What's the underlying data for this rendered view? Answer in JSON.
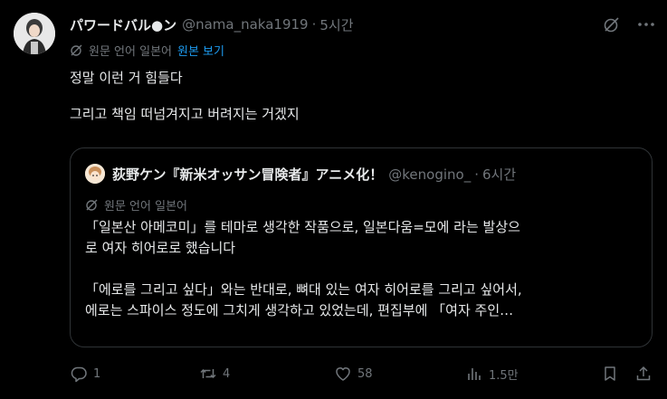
{
  "tweet": {
    "display_name": "パワードバル●ン",
    "handle": "@nama_naka1919",
    "separator": "·",
    "time": "5시간",
    "translate": {
      "label": "원문 언어 일본어",
      "show_original": "원본 보기"
    },
    "body_lines": [
      "정말 이런 거 힘들다",
      "",
      "그리고 책임 떠넘겨지고 버려지는 거겠지"
    ]
  },
  "quote": {
    "display_name": "荻野ケン『新米オッサン冒険者』アニメ化！",
    "handle": "@kenogino_",
    "separator": "·",
    "time": "6시간",
    "translate_label": "원문 언어 일본어",
    "body_lines": [
      "「일본산 아메코미」를 테마로 생각한 작품으로, 일본다움=모에 라는 발상으",
      "로 여자 히어로로 했습니다",
      "",
      "「에로를 그리고 싶다」와는 반대로, 뼈대 있는 여자 히어로를 그리고 싶어서,",
      "에로는 스파이스 정도에 그치게 생각하고 있었는데, 편집부에 「여자 주인…"
    ]
  },
  "actions": {
    "reply": "1",
    "retweet": "4",
    "like": "58",
    "views": "1.5만"
  },
  "icons": {
    "grok": "grok-icon",
    "more": "more-options-icon",
    "translate": "translate-icon",
    "reply": "reply-icon",
    "retweet": "retweet-icon",
    "like": "heart-icon",
    "views": "views-chart-icon",
    "bookmark": "bookmark-icon",
    "share": "share-icon"
  },
  "colors": {
    "background": "#000000",
    "text": "#e7e9ea",
    "secondary": "#71767b",
    "accent": "#1d9bf0",
    "border": "#2f3336"
  }
}
